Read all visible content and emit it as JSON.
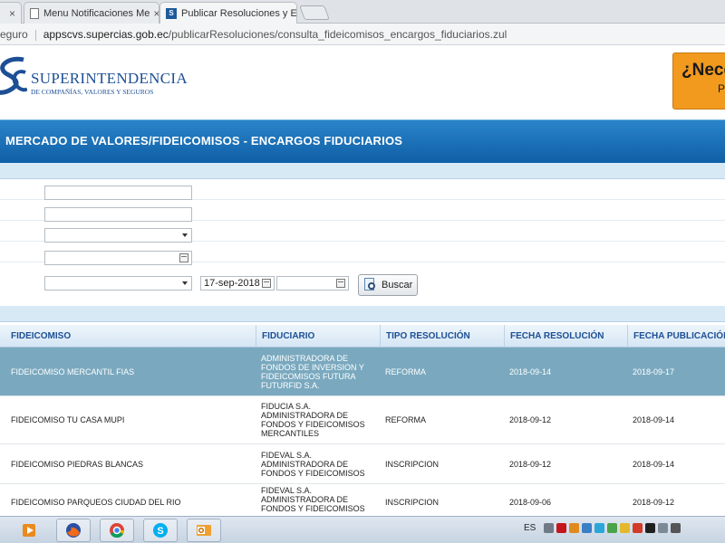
{
  "browser": {
    "tabs": [
      {
        "label": "Menu Notificaciones Me"
      },
      {
        "label": "Publicar Resoluciones y E"
      }
    ],
    "tab_close": "×",
    "address": {
      "prefix": "eguro",
      "host": "appscvs.supercias.gob.ec",
      "path": "/publicarResoluciones/consulta_fideicomisos_encargos_fiduciarios.zul"
    }
  },
  "site": {
    "logo_title": "SUPERINTENDENCIA",
    "logo_subtitle": "DE COMPAÑÍAS, VALORES Y SEGUROS",
    "help_button": {
      "line1": "¿Nece",
      "line2": "P"
    },
    "page_title": "MERCADO DE VALORES/FIDEICOMISOS - ENCARGOS FIDUCIARIOS"
  },
  "filters": {
    "field1": "",
    "field2": "",
    "select1": "",
    "date1": "",
    "select2": "",
    "date_from": "17-sep-2018",
    "date_to": "",
    "search_button": "Buscar"
  },
  "table": {
    "columns": [
      "FIDEICOMISO",
      "FIDUCIARIO",
      "TIPO RESOLUCIÓN",
      "FECHA RESOLUCIÓN",
      "FECHA PUBLICACIÓN"
    ],
    "rows": [
      {
        "fideicomiso": "FIDEICOMISO MERCANTIL FIAS",
        "fiduciario": "ADMINISTRADORA DE FONDOS DE INVERSION Y FIDEICOMISOS FUTURA FUTURFID S.A.",
        "tipo": "REFORMA",
        "fecha_res": "2018-09-14",
        "fecha_pub": "2018-09-17"
      },
      {
        "fideicomiso": "FIDEICOMISO TU CASA MUPI",
        "fiduciario": "FIDUCIA S.A. ADMINISTRADORA DE FONDOS Y FIDEICOMISOS MERCANTILES",
        "tipo": "REFORMA",
        "fecha_res": "2018-09-12",
        "fecha_pub": "2018-09-14"
      },
      {
        "fideicomiso": "FIDEICOMISO PIEDRAS BLANCAS",
        "fiduciario": "FIDEVAL S.A. ADMINISTRADORA DE FONDOS Y FIDEICOMISOS",
        "tipo": "INSCRIPCION",
        "fecha_res": "2018-09-12",
        "fecha_pub": "2018-09-14"
      },
      {
        "fideicomiso": "FIDEICOMISO PARQUEOS CIUDAD DEL RIO",
        "fiduciario": "FIDEVAL S.A. ADMINISTRADORA DE FONDOS Y FIDEICOMISOS",
        "tipo": "INSCRIPCION",
        "fecha_res": "2018-09-06",
        "fecha_pub": "2018-09-12"
      }
    ]
  },
  "taskbar": {
    "apps": [
      "media-player-icon",
      "firefox-icon",
      "chrome-icon",
      "skype-icon",
      "outlook-icon"
    ],
    "language": "ES"
  }
}
